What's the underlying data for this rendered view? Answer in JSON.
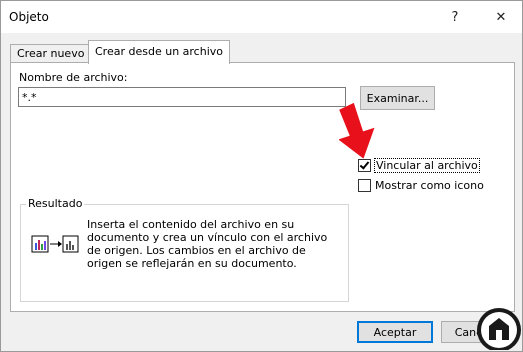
{
  "window": {
    "title": "Objeto",
    "help_glyph": "?",
    "close_glyph": "✕"
  },
  "tabs": [
    {
      "label": "Crear nuevo"
    },
    {
      "label": "Crear desde un archivo"
    }
  ],
  "file": {
    "label": "Nombre de archivo:",
    "value": "*.*",
    "browse_label": "Examinar..."
  },
  "options": {
    "link_label": "Vincular al archivo",
    "link_checked": true,
    "icon_label": "Mostrar como icono",
    "icon_checked": false
  },
  "result": {
    "title": "Resultado",
    "text": "Inserta el contenido del archivo en su documento y crea un vínculo con el archivo de origen. Los cambios en el archivo de origen se reflejarán en su documento."
  },
  "buttons": {
    "ok": "Aceptar",
    "cancel": "Cancelar"
  },
  "colors": {
    "accent": "#0078d7",
    "arrow": "#e8101a"
  },
  "icons": [
    "help-icon",
    "close-icon",
    "red-arrow-icon",
    "linked-file-icon",
    "checkmark-icon"
  ]
}
